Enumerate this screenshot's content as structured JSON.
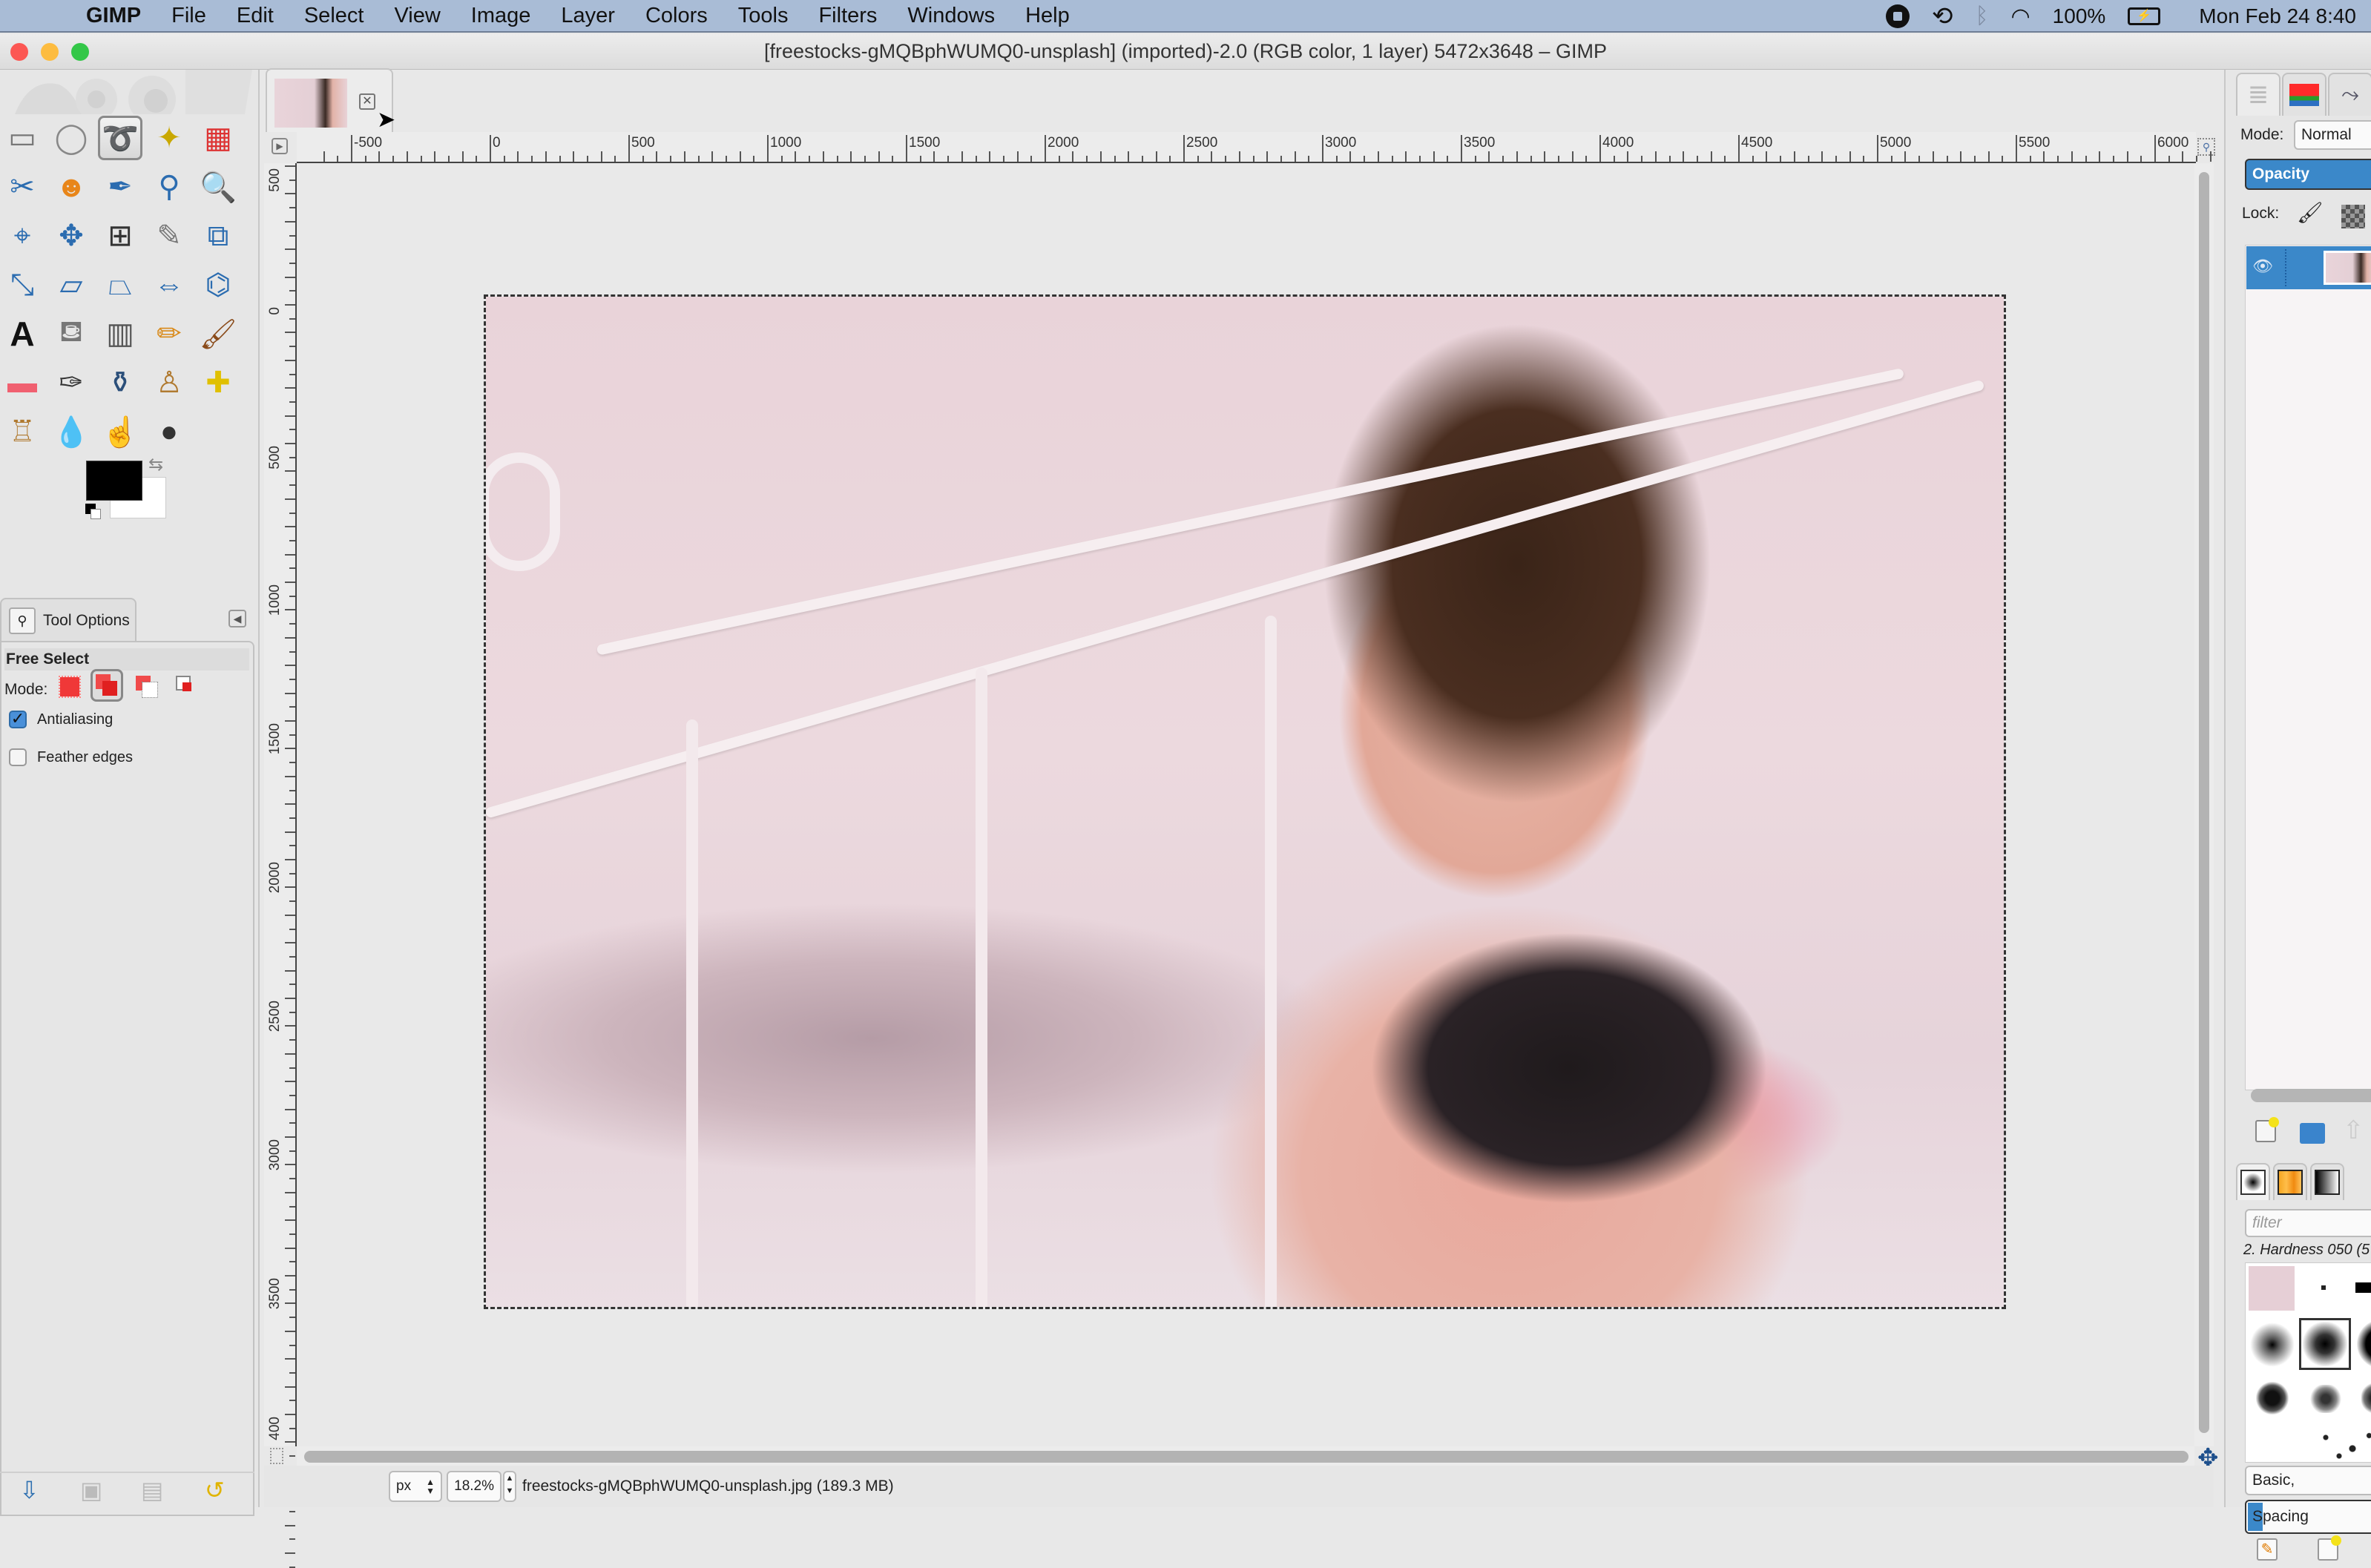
{
  "menubar": {
    "app": "GIMP",
    "items": [
      "File",
      "Edit",
      "Select",
      "View",
      "Image",
      "Layer",
      "Colors",
      "Tools",
      "Filters",
      "Windows",
      "Help"
    ],
    "status": {
      "battery": "100%",
      "clock": "Mon Feb 24  8:40"
    }
  },
  "window": {
    "title": "[freestocks-gMQBphWUMQ0-unsplash] (imported)-2.0 (RGB color, 1 layer) 5472x3648 – GIMP"
  },
  "toolbox": {
    "tools": [
      {
        "name": "rect-select",
        "glyph": "▭"
      },
      {
        "name": "ellipse-select",
        "glyph": "◯"
      },
      {
        "name": "free-select",
        "glyph": "➰",
        "active": true
      },
      {
        "name": "fuzzy-select",
        "glyph": "✦"
      },
      {
        "name": "select-by-color",
        "glyph": "▦"
      },
      {
        "name": "scissors-select",
        "glyph": "✂"
      },
      {
        "name": "foreground-select",
        "glyph": "☻"
      },
      {
        "name": "paths",
        "glyph": "✒"
      },
      {
        "name": "color-picker",
        "glyph": "⚲"
      },
      {
        "name": "zoom",
        "glyph": "🔍"
      },
      {
        "name": "measure",
        "glyph": "⌖"
      },
      {
        "name": "move",
        "glyph": "✥"
      },
      {
        "name": "align",
        "glyph": "⊞"
      },
      {
        "name": "crop",
        "glyph": "✎"
      },
      {
        "name": "unified-transform",
        "glyph": "⧉"
      },
      {
        "name": "scale",
        "glyph": "⤡"
      },
      {
        "name": "shear",
        "glyph": "▱"
      },
      {
        "name": "perspective",
        "glyph": "⏢"
      },
      {
        "name": "flip",
        "glyph": "⇔"
      },
      {
        "name": "cage-transform",
        "glyph": "⌬"
      },
      {
        "name": "text",
        "glyph": "A"
      },
      {
        "name": "bucket-fill",
        "glyph": "⛾"
      },
      {
        "name": "blend",
        "glyph": "▥"
      },
      {
        "name": "pencil",
        "glyph": "✏"
      },
      {
        "name": "paintbrush",
        "glyph": "🖌"
      },
      {
        "name": "eraser",
        "glyph": "▬"
      },
      {
        "name": "airbrush",
        "glyph": "✑"
      },
      {
        "name": "ink",
        "glyph": "⚱"
      },
      {
        "name": "clone",
        "glyph": "♙"
      },
      {
        "name": "heal",
        "glyph": "✚"
      },
      {
        "name": "perspective-clone",
        "glyph": "♖"
      },
      {
        "name": "blur-sharpen",
        "glyph": "💧"
      },
      {
        "name": "smudge",
        "glyph": "☝"
      },
      {
        "name": "dodge-burn",
        "glyph": "●"
      }
    ],
    "colors": {
      "foreground": "#000000",
      "background": "#ffffff"
    }
  },
  "tool_options": {
    "tab_label": "Tool Options",
    "tool_name": "Free Select",
    "mode_label": "Mode:",
    "antialiasing": {
      "label": "Antialiasing",
      "checked": true
    },
    "feather_edges": {
      "label": "Feather edges",
      "checked": false
    }
  },
  "canvas": {
    "ruler_h": [
      "-500",
      "0",
      "500",
      "1000",
      "1500",
      "2000",
      "2500",
      "3000",
      "3500",
      "4000",
      "4500",
      "5000",
      "5500",
      "6000"
    ],
    "ruler_v": [
      "500",
      "0",
      "500",
      "1000",
      "1500",
      "2000",
      "2500",
      "3000",
      "3500",
      "400"
    ]
  },
  "statusbar": {
    "unit": "px",
    "zoom": "18.2%",
    "file_info": "freestocks-gMQBphWUMQ0-unsplash.jpg (189.3 MB)"
  },
  "layers": {
    "mode_label": "Mode:",
    "mode_value": "Normal",
    "opacity_label": "Opacity",
    "lock_label": "Lock:"
  },
  "brushes": {
    "filter_placeholder": "filter",
    "selected_brush": "2. Hardness 050 (5",
    "tags_value": "Basic,",
    "spacing_label": "Spacing"
  }
}
